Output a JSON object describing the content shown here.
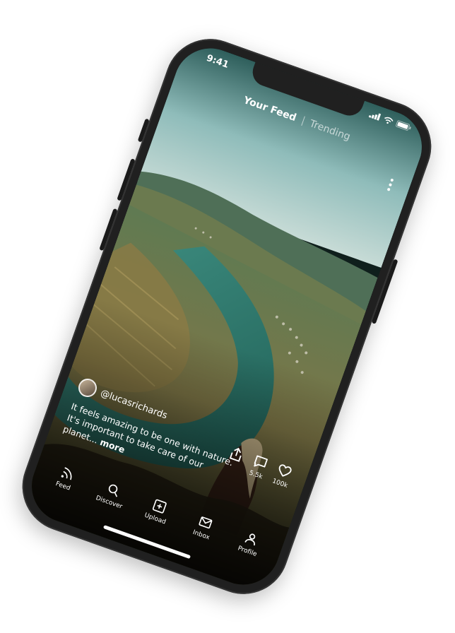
{
  "status_bar": {
    "time": "9:41",
    "icons": [
      "signal-icon",
      "wifi-icon",
      "battery-icon"
    ]
  },
  "top_tabs": {
    "active": "Your Feed",
    "inactive": "Trending"
  },
  "post": {
    "username": "@lucasrichards",
    "caption": "It feels amazing to be one with nature. It's important to take care of our planet...",
    "more_label": "more",
    "share_icon": "share-icon",
    "comments": {
      "icon": "comment-icon",
      "count": "5.5k"
    },
    "likes": {
      "icon": "heart-icon",
      "count": "100k"
    }
  },
  "bottom_nav": [
    {
      "label": "Feed",
      "icon": "feed-icon"
    },
    {
      "label": "Discover",
      "icon": "search-icon"
    },
    {
      "label": "Upload",
      "icon": "upload-icon"
    },
    {
      "label": "Inbox",
      "icon": "mail-icon"
    },
    {
      "label": "Profile",
      "icon": "profile-icon"
    }
  ],
  "colors": {
    "phone_frame": "#202020",
    "text": "#ffffff",
    "sky": "#9fc7c5",
    "river": "#2f7f73"
  }
}
